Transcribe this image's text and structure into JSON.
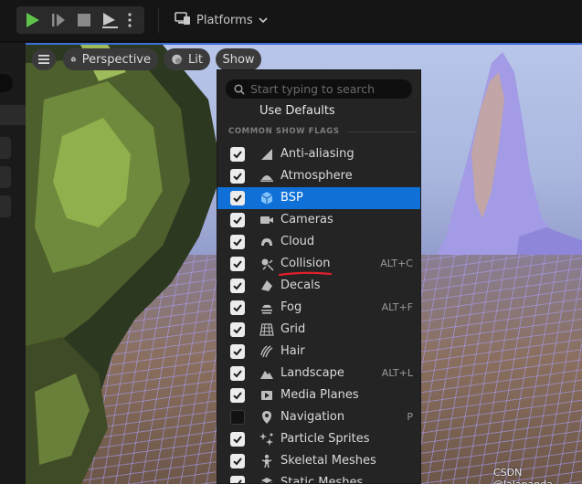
{
  "toolbar": {
    "play_icon": "play-icon",
    "step_icon": "skip-forward-icon",
    "stop_icon": "stop-icon",
    "eject_icon": "eject-icon",
    "more_icon": "kebab-icon",
    "platforms_label": "Platforms"
  },
  "viewport": {
    "perspective_label": "Perspective",
    "lit_label": "Lit",
    "show_label": "Show"
  },
  "show_menu": {
    "search_placeholder": "Start typing to search",
    "use_defaults": "Use Defaults",
    "section_title": "COMMON SHOW FLAGS",
    "items": [
      {
        "label": "Anti-aliasing",
        "checked": true,
        "icon": "anti-aliasing-icon",
        "shortcut": ""
      },
      {
        "label": "Atmosphere",
        "checked": true,
        "icon": "atmosphere-icon",
        "shortcut": ""
      },
      {
        "label": "BSP",
        "checked": true,
        "icon": "bsp-cube-icon",
        "shortcut": "",
        "selected": true
      },
      {
        "label": "Cameras",
        "checked": true,
        "icon": "camera-icon",
        "shortcut": ""
      },
      {
        "label": "Cloud",
        "checked": true,
        "icon": "cloud-icon",
        "shortcut": ""
      },
      {
        "label": "Collision",
        "checked": true,
        "icon": "collision-icon",
        "shortcut": "ALT+C"
      },
      {
        "label": "Decals",
        "checked": true,
        "icon": "decal-icon",
        "shortcut": ""
      },
      {
        "label": "Fog",
        "checked": true,
        "icon": "fog-icon",
        "shortcut": "ALT+F"
      },
      {
        "label": "Grid",
        "checked": true,
        "icon": "grid-icon",
        "shortcut": ""
      },
      {
        "label": "Hair",
        "checked": true,
        "icon": "hair-icon",
        "shortcut": ""
      },
      {
        "label": "Landscape",
        "checked": true,
        "icon": "landscape-icon",
        "shortcut": "ALT+L"
      },
      {
        "label": "Media Planes",
        "checked": true,
        "icon": "media-planes-icon",
        "shortcut": ""
      },
      {
        "label": "Navigation",
        "checked": false,
        "icon": "navigation-icon",
        "shortcut": "P"
      },
      {
        "label": "Particle Sprites",
        "checked": true,
        "icon": "particle-sprites-icon",
        "shortcut": ""
      },
      {
        "label": "Skeletal Meshes",
        "checked": true,
        "icon": "skeletal-mesh-icon",
        "shortcut": ""
      },
      {
        "label": "Static Meshes",
        "checked": true,
        "icon": "static-mesh-icon",
        "shortcut": ""
      }
    ]
  },
  "watermark": "CSDN @lalapanda",
  "colors": {
    "selection": "#0f70d7",
    "play_green": "#5fc34a",
    "annotation_red": "#e0202a"
  }
}
